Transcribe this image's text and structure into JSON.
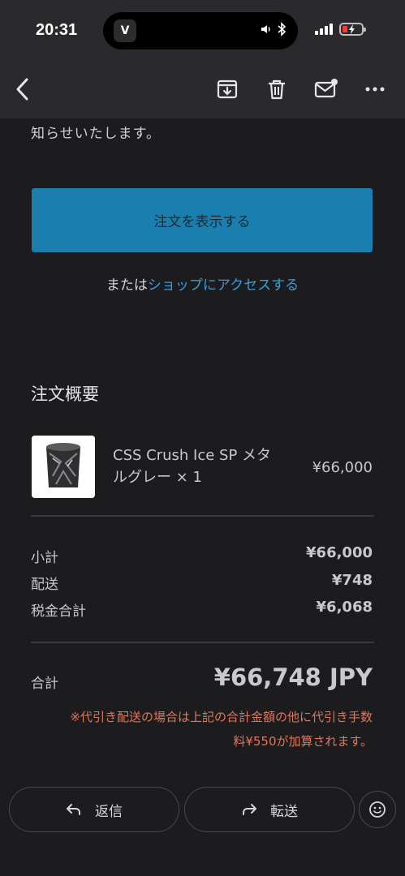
{
  "status_bar": {
    "time": "20:31",
    "island_app_letter": "V",
    "battery_color": "#ff3b30"
  },
  "nav": {
    "icons": [
      "back-chevron-icon",
      "archive-icon",
      "trash-icon",
      "mail-unread-icon",
      "more-icon"
    ]
  },
  "email": {
    "intro_text": "知らせいたします。",
    "view_order_button": "注文を表示する",
    "or_prefix": "または",
    "shop_link": "ショップにアクセスする",
    "summary_title": "注文概要",
    "product": {
      "name": "CSS Crush Ice SP メタルグレー × 1",
      "price": "¥66,000"
    },
    "subtotal_label": "小計",
    "subtotal_value": "¥66,000",
    "shipping_label": "配送",
    "shipping_value": "¥748",
    "tax_label": "税金合計",
    "tax_value": "¥6,068",
    "total_label": "合計",
    "total_value": "¥66,748 JPY",
    "note_line1": "※代引き配送の場合は上記の合計金額の他に代引き手数",
    "note_line2": "料¥550が加算されます。",
    "accent_color": "#1a7fae",
    "link_color": "#3c9cd6",
    "note_color": "#e0765a"
  },
  "actions": {
    "reply_label": "返信",
    "forward_label": "転送"
  }
}
